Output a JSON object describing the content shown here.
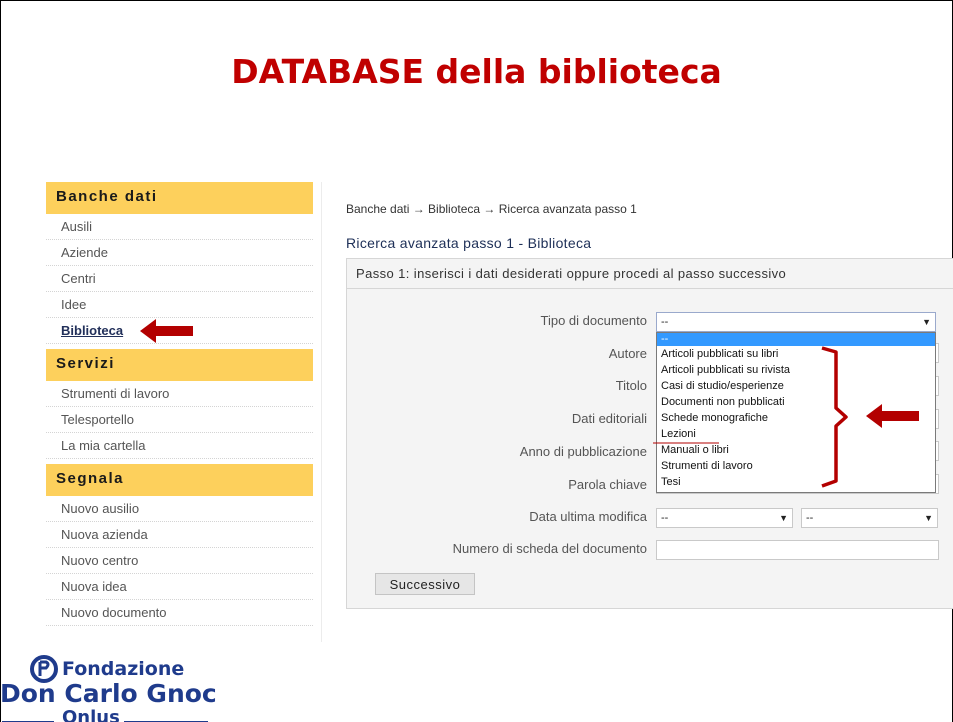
{
  "slide": {
    "title": "DATABASE della biblioteca"
  },
  "sidebar": {
    "sections": [
      {
        "heading": "Banche dati",
        "items": [
          "Ausili",
          "Aziende",
          "Centri",
          "Idee",
          "Biblioteca"
        ],
        "active": "Biblioteca"
      },
      {
        "heading": "Servizi",
        "items": [
          "Strumenti di lavoro",
          "Telesportello",
          "La mia cartella"
        ]
      },
      {
        "heading": "Segnala",
        "items": [
          "Nuovo ausilio",
          "Nuova azienda",
          "Nuovo centro",
          "Nuova idea",
          "Nuovo documento"
        ]
      }
    ]
  },
  "breadcrumb": "Banche dati → Biblioteca → Ricerca avanzata passo 1",
  "page_title": "Ricerca avanzata passo 1 - Biblioteca",
  "form": {
    "panel_heading": "Passo 1: inserisci i dati desiderati oppure procedi al passo successivo",
    "labels": {
      "tipo": "Tipo di documento",
      "autore": "Autore",
      "titolo": "Titolo",
      "dati": "Dati editoriali",
      "anno": "Anno di pubblicazione",
      "parola": "Parola chiave",
      "data_mod": "Data ultima modifica",
      "numero": "Numero di scheda del documento"
    },
    "tipo_selected": "--",
    "data_mod_day": "--",
    "data_mod_year": "--",
    "dropdown_options": [
      "--",
      "Articoli pubblicati su libri",
      "Articoli pubblicati su rivista",
      "Casi di studio/esperienze",
      "Documenti non pubblicati",
      "Schede monografiche",
      "Lezioni",
      "Manuali o libri",
      "Strumenti di lavoro",
      "Tesi"
    ],
    "submit_label": "Successivo"
  },
  "logo": {
    "line1": "Fondazione",
    "line2": "Don Carlo Gnoc",
    "line3": "Onlus"
  },
  "colors": {
    "title_red": "#c00000",
    "sidebar_header": "#fdd05c",
    "annotation_red": "#b30000",
    "logo_blue": "#1f3b8c",
    "option_highlight": "#3399ff"
  }
}
